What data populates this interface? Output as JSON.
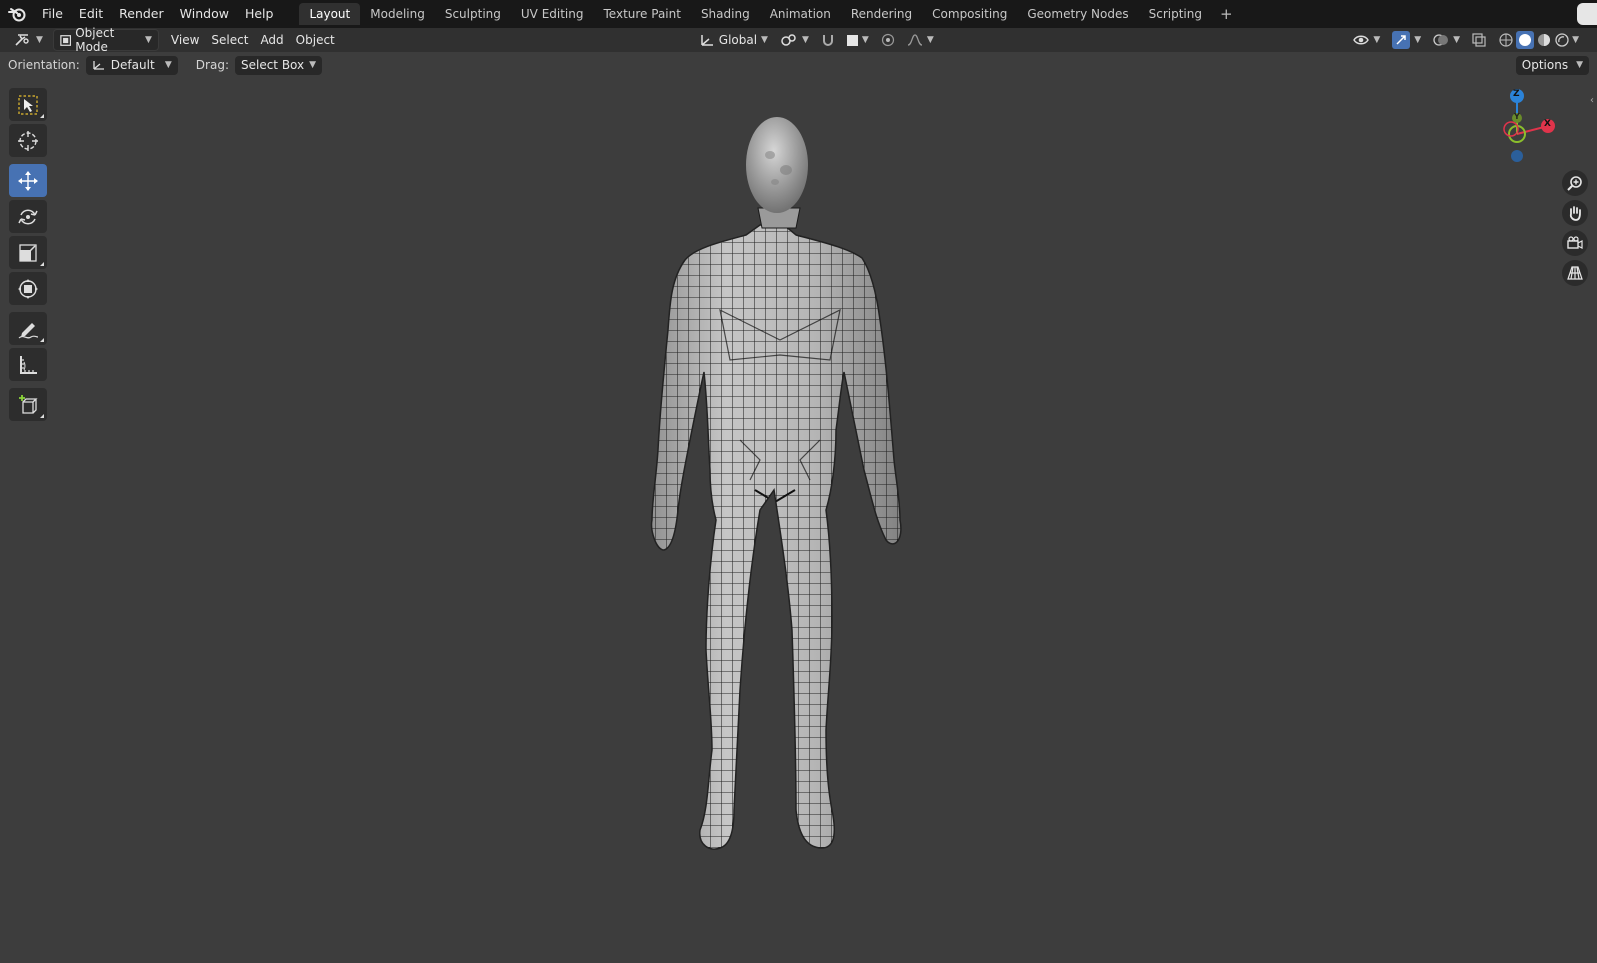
{
  "menubar": {
    "items": [
      "File",
      "Edit",
      "Render",
      "Window",
      "Help"
    ],
    "workspaces": [
      "Layout",
      "Modeling",
      "Sculpting",
      "UV Editing",
      "Texture Paint",
      "Shading",
      "Animation",
      "Rendering",
      "Compositing",
      "Geometry Nodes",
      "Scripting"
    ],
    "add_symbol": "+"
  },
  "header": {
    "mode": "Object Mode",
    "menus": [
      "View",
      "Select",
      "Add",
      "Object"
    ],
    "transform_orientation": "Global"
  },
  "subheader": {
    "orientation_label": "Orientation:",
    "orientation_value": "Default",
    "drag_label": "Drag:",
    "drag_value": "Select Box",
    "options_label": "Options"
  },
  "toolbar": {
    "tools": [
      "select-box",
      "cursor",
      "move",
      "rotate",
      "scale",
      "transform",
      "annotate",
      "measure",
      "add-cube"
    ],
    "active_tool": "move"
  },
  "gizmo": {
    "axes": {
      "z": "Z",
      "y": "Y",
      "x": "X"
    },
    "colors": {
      "x": "#e0344b",
      "y": "#8bbf2c",
      "z": "#2b83d8",
      "accent": "#4772b3"
    }
  },
  "viewport": {
    "object": "human base mesh (wireframe overlay)"
  }
}
